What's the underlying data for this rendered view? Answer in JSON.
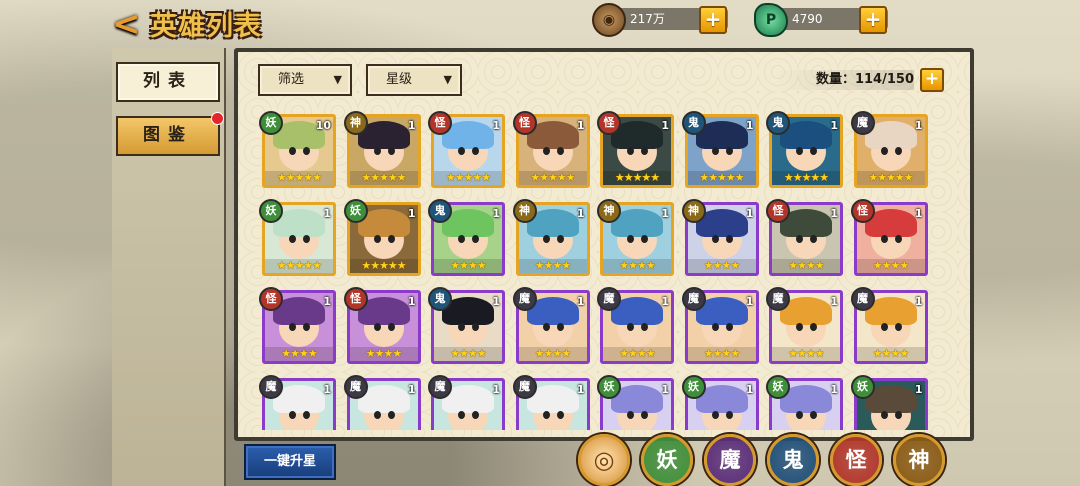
{
  "header": {
    "back_glyph": "<",
    "title": "英雄列表",
    "coins": "217万",
    "jade": "4790",
    "coin_icon": "copper-coin-icon",
    "jade_icon": "jade-gem-icon"
  },
  "sidebar": {
    "list_label": "列表",
    "dex_label": "图鉴"
  },
  "filters": {
    "filter_label": "筛选",
    "star_label": "星级",
    "count_label": "数量：114/150"
  },
  "colors": {
    "yao": "#3f8f3a",
    "shen": "#8a6a1a",
    "guai": "#b2352a",
    "gui": "#20557a",
    "mo": "#3d3a46"
  },
  "heroes": [
    {
      "faction": "妖",
      "level": "10",
      "stars": "★★★★★",
      "border": "gold",
      "hair": "#a8c06a",
      "bg": "#e6c98e"
    },
    {
      "faction": "神",
      "level": "1",
      "stars": "★★★★★",
      "border": "gold",
      "hair": "#2a2230",
      "bg": "#c9a865"
    },
    {
      "faction": "怪",
      "level": "1",
      "stars": "★★★★★",
      "border": "gold",
      "hair": "#6fb3e8",
      "bg": "#b8d6ec"
    },
    {
      "faction": "怪",
      "level": "1",
      "stars": "★★★★★",
      "border": "gold",
      "hair": "#8a5a3a",
      "bg": "#d7b27a"
    },
    {
      "faction": "怪",
      "level": "1",
      "stars": "★★★★★",
      "border": "gold",
      "hair": "#1f2a2a",
      "bg": "#3b4a44"
    },
    {
      "faction": "鬼",
      "level": "1",
      "stars": "★★★★★",
      "border": "gold",
      "hair": "#1d2d55",
      "bg": "#7ea3c9"
    },
    {
      "faction": "鬼",
      "level": "1",
      "stars": "★★★★★",
      "border": "gold",
      "hair": "#1a4f80",
      "bg": "#2a6a8a"
    },
    {
      "faction": "魔",
      "level": "1",
      "stars": "★★★★★",
      "border": "gold",
      "hair": "#e9d6c2",
      "bg": "#e0b06a"
    },
    {
      "faction": "妖",
      "level": "1",
      "stars": "★★★★★",
      "border": "gold",
      "hair": "#bfe0c8",
      "bg": "#d8e8d5"
    },
    {
      "faction": "妖",
      "level": "1",
      "stars": "★★★★★",
      "border": "gold",
      "hair": "#c68a3b",
      "bg": "#8a6a3a"
    },
    {
      "faction": "鬼",
      "level": "1",
      "stars": "★★★★",
      "border": "purple",
      "hair": "#6ec45e",
      "bg": "#a6d28a"
    },
    {
      "faction": "神",
      "level": "1",
      "stars": "★★★★",
      "border": "gold",
      "hair": "#4fa3c0",
      "bg": "#9fd0e0"
    },
    {
      "faction": "神",
      "level": "1",
      "stars": "★★★★",
      "border": "gold",
      "hair": "#4fa3c0",
      "bg": "#9fd0e0"
    },
    {
      "faction": "神",
      "level": "1",
      "stars": "★★★★",
      "border": "purple",
      "hair": "#2c3f8a",
      "bg": "#cdd2e8"
    },
    {
      "faction": "怪",
      "level": "1",
      "stars": "★★★★",
      "border": "purple",
      "hair": "#3e4a3a",
      "bg": "#c9c5b0"
    },
    {
      "faction": "怪",
      "level": "1",
      "stars": "★★★★",
      "border": "purple",
      "hair": "#d63c3c",
      "bg": "#f0b0a0"
    },
    {
      "faction": "怪",
      "level": "1",
      "stars": "★★★★",
      "border": "purple",
      "hair": "#6a3a8a",
      "bg": "#c890d8"
    },
    {
      "faction": "怪",
      "level": "1",
      "stars": "★★★★",
      "border": "purple",
      "hair": "#6a3a8a",
      "bg": "#c890d8"
    },
    {
      "faction": "鬼",
      "level": "1",
      "stars": "★★★★",
      "border": "purple",
      "hair": "#1a1a22",
      "bg": "#e8dcc6"
    },
    {
      "faction": "魔",
      "level": "1",
      "stars": "★★★★",
      "border": "purple",
      "hair": "#3a5fc0",
      "bg": "#f2d0a8"
    },
    {
      "faction": "魔",
      "level": "1",
      "stars": "★★★★",
      "border": "purple",
      "hair": "#3a5fc0",
      "bg": "#f2d0a8"
    },
    {
      "faction": "魔",
      "level": "1",
      "stars": "★★★★",
      "border": "purple",
      "hair": "#3a5fc0",
      "bg": "#f2d0a8"
    },
    {
      "faction": "魔",
      "level": "1",
      "stars": "★★★★",
      "border": "purple",
      "hair": "#e8a030",
      "bg": "#f4e6c8"
    },
    {
      "faction": "魔",
      "level": "1",
      "stars": "★★★★",
      "border": "purple",
      "hair": "#e8a030",
      "bg": "#f4e6c8"
    },
    {
      "faction": "魔",
      "level": "1",
      "stars": "★★★★",
      "border": "purple",
      "hair": "#f0f0f0",
      "bg": "#c8e6e0"
    },
    {
      "faction": "魔",
      "level": "1",
      "stars": "★★★★",
      "border": "purple",
      "hair": "#f0f0f0",
      "bg": "#c8e6e0"
    },
    {
      "faction": "魔",
      "level": "1",
      "stars": "★★★★",
      "border": "purple",
      "hair": "#f0f0f0",
      "bg": "#c8e6e0"
    },
    {
      "faction": "魔",
      "level": "1",
      "stars": "★★★★",
      "border": "purple",
      "hair": "#f0f0f0",
      "bg": "#c8e6e0"
    },
    {
      "faction": "妖",
      "level": "1",
      "stars": "★★★★",
      "border": "purple",
      "hair": "#8a88d8",
      "bg": "#d8d0f0"
    },
    {
      "faction": "妖",
      "level": "1",
      "stars": "★★★★",
      "border": "purple",
      "hair": "#8a88d8",
      "bg": "#d8d0f0"
    },
    {
      "faction": "妖",
      "level": "1",
      "stars": "★★★★",
      "border": "purple",
      "hair": "#8a88d8",
      "bg": "#d8d0f0"
    },
    {
      "faction": "妖",
      "level": "1",
      "stars": "★★★★",
      "border": "purple",
      "hair": "#5a4a3a",
      "bg": "#2a5a5a"
    }
  ],
  "bottom": {
    "upgrade_label": "一键升星",
    "faction_filters": [
      {
        "label": "◎",
        "color": "#d68d33",
        "name": "filter-all"
      },
      {
        "label": "妖",
        "color": "#3f8f3a",
        "name": "filter-yao"
      },
      {
        "label": "魔",
        "color": "#5a2d7a",
        "name": "filter-mo"
      },
      {
        "label": "鬼",
        "color": "#1f4f7a",
        "name": "filter-gui"
      },
      {
        "label": "怪",
        "color": "#b2352a",
        "name": "filter-guai"
      },
      {
        "label": "神",
        "color": "#8a5a14",
        "name": "filter-shen"
      }
    ]
  }
}
